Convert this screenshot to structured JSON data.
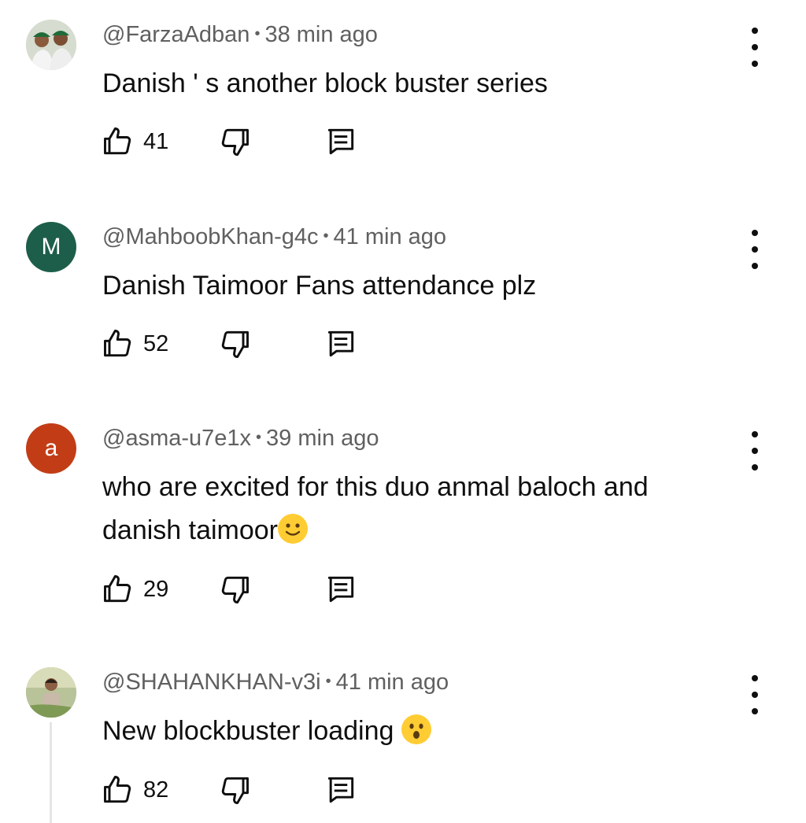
{
  "separator": "•",
  "comments": [
    {
      "handle": "@FarzaAdban",
      "time": "38 min ago",
      "text": "Danish ' s another block buster series",
      "likes": "41",
      "avatar": {
        "type": "photo",
        "color": "#5d7a55"
      }
    },
    {
      "handle": "@MahboobKhan-g4c",
      "time": "41 min ago",
      "text": "Danish Taimoor Fans attendance plz",
      "likes": "52",
      "avatar": {
        "type": "letter",
        "letter": "M",
        "color": "#1d5e4a"
      }
    },
    {
      "handle": "@asma-u7e1x",
      "time": "39 min ago",
      "text_line1": "who are excited  for this duo anmal baloch and",
      "text_line2": "danish taimoor",
      "emoji": "slightly-smiling-face",
      "likes": "29",
      "avatar": {
        "type": "letter",
        "letter": "a",
        "color": "#c23d16"
      }
    },
    {
      "handle": "@SHAHANKHAN-v3i",
      "time": "41 min ago",
      "text": "New blockbuster loading ",
      "emoji": "hushed-face",
      "likes": "82",
      "avatar": {
        "type": "photo",
        "color": "#a7b08a"
      }
    }
  ],
  "icons": {
    "like": "thumbs-up-icon",
    "dislike": "thumbs-down-icon",
    "reply": "reply-comment-icon",
    "menu": "more-vertical-icon"
  }
}
